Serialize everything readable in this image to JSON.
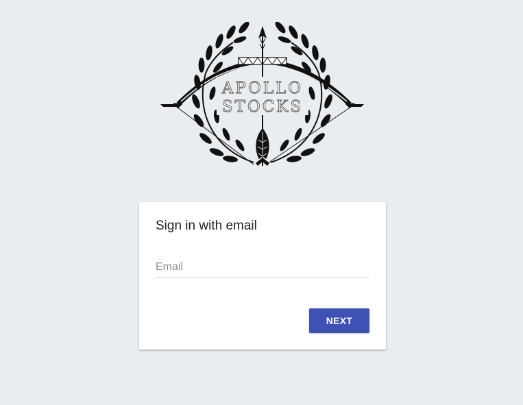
{
  "logo": {
    "line1": "APOLLO",
    "line2": "STOCKS",
    "icon": "laurel-bow-arrow-logo"
  },
  "signin": {
    "title": "Sign in with email",
    "email_placeholder": "Email",
    "email_value": "",
    "next_label": "NEXT"
  },
  "colors": {
    "background": "#eaedf0",
    "card": "#ffffff",
    "primary": "#3f51b5",
    "title_text": "#212121",
    "placeholder_text": "#8a8a8a"
  }
}
